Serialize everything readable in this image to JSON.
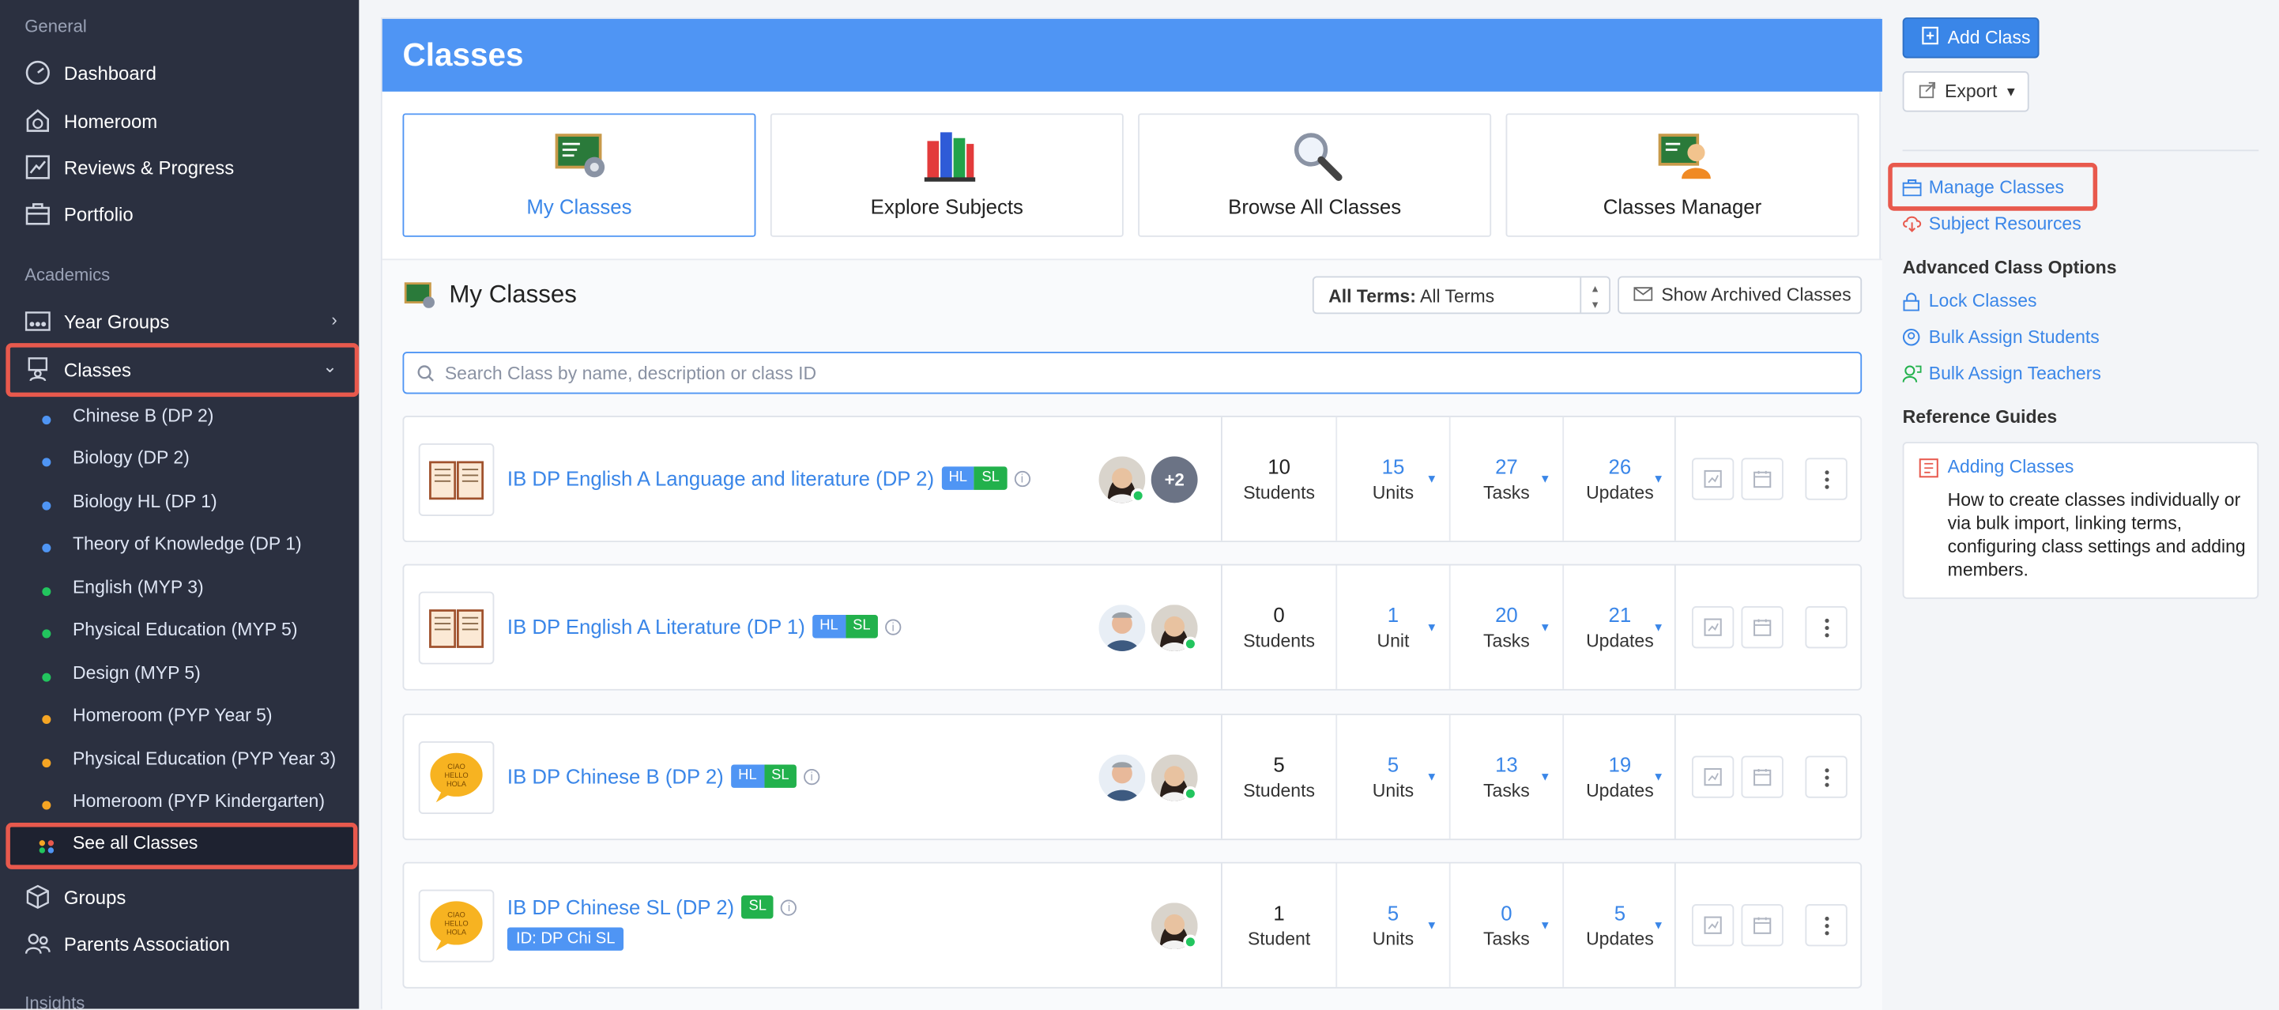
{
  "sidebar": {
    "general_label": "General",
    "academics_label": "Academics",
    "insights_label": "Insights",
    "items": {
      "dashboard": "Dashboard",
      "homeroom": "Homeroom",
      "reviews": "Reviews & Progress",
      "portfolio": "Portfolio",
      "year_groups": "Year Groups",
      "classes": "Classes",
      "groups": "Groups",
      "parents": "Parents Association"
    },
    "class_list": [
      {
        "label": "Chinese B (DP 2)",
        "color": "#4f95f4"
      },
      {
        "label": "Biology (DP 2)",
        "color": "#4f95f4"
      },
      {
        "label": "Biology HL (DP 1)",
        "color": "#4f95f4"
      },
      {
        "label": "Theory of Knowledge (DP 1)",
        "color": "#4f95f4"
      },
      {
        "label": "English (MYP 3)",
        "color": "#22c55e"
      },
      {
        "label": "Physical Education (MYP 5)",
        "color": "#22c55e"
      },
      {
        "label": "Design (MYP 5)",
        "color": "#22c55e"
      },
      {
        "label": "Homeroom (PYP Year 5)",
        "color": "#f5a524"
      },
      {
        "label": "Physical Education (PYP Year 3)",
        "color": "#f5a524"
      },
      {
        "label": "Homeroom (PYP Kindergarten)",
        "color": "#f5a524"
      }
    ],
    "see_all": "See all Classes"
  },
  "main": {
    "title": "Classes",
    "tiles": [
      "My Classes",
      "Explore Subjects",
      "Browse All Classes",
      "Classes Manager"
    ],
    "section_title": "My Classes",
    "term_label": "All Terms:",
    "term_value": "All Terms",
    "archived_label": "Show Archived Classes",
    "search_placeholder": "Search Class by name, description or class ID",
    "classes": [
      {
        "name": "IB DP English A Language and literature (DP 2)",
        "hl": "HL",
        "sl": "SL",
        "extra": "+2",
        "students": "10",
        "students_label": "Students",
        "units": "15",
        "units_label": "Units",
        "tasks": "27",
        "tasks_label": "Tasks",
        "updates": "26",
        "updates_label": "Updates"
      },
      {
        "name": "IB DP English A Literature (DP 1)",
        "hl": "HL",
        "sl": "SL",
        "students": "0",
        "students_label": "Students",
        "units": "1",
        "units_label": "Unit",
        "tasks": "20",
        "tasks_label": "Tasks",
        "updates": "21",
        "updates_label": "Updates"
      },
      {
        "name": "IB DP Chinese B (DP 2)",
        "hl": "HL",
        "sl": "SL",
        "students": "5",
        "students_label": "Students",
        "units": "5",
        "units_label": "Units",
        "tasks": "13",
        "tasks_label": "Tasks",
        "updates": "19",
        "updates_label": "Updates"
      },
      {
        "name": "IB DP Chinese SL (DP 2)",
        "sl": "SL",
        "id_tag": "ID: DP Chi SL",
        "students": "1",
        "students_label": "Student",
        "units": "5",
        "units_label": "Units",
        "tasks": "0",
        "tasks_label": "Tasks",
        "updates": "5",
        "updates_label": "Updates"
      }
    ]
  },
  "right": {
    "add_class": "Add Class",
    "export": "Export",
    "manage_classes": "Manage Classes",
    "subject_resources": "Subject Resources",
    "advanced_heading": "Advanced Class Options",
    "lock_classes": "Lock Classes",
    "bulk_students": "Bulk Assign Students",
    "bulk_teachers": "Bulk Assign Teachers",
    "reference_heading": "Reference Guides",
    "guide_title": "Adding Classes",
    "guide_desc": "How to create classes individually or via bulk import, linking terms, configuring class settings and adding members."
  },
  "colors": {
    "accent": "#4f95f4",
    "sidebar": "#2b3040",
    "highlight": "#e8594d",
    "online": "#22c55e"
  }
}
